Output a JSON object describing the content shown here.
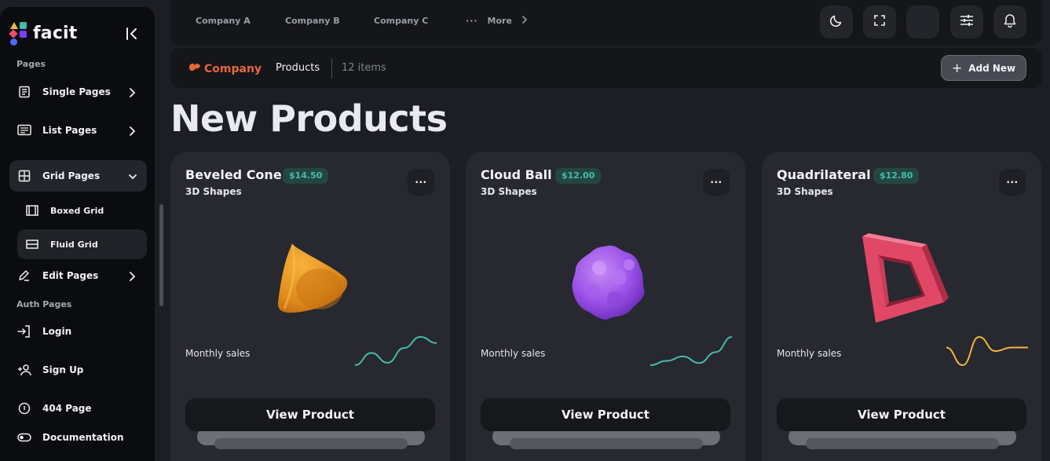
{
  "brand": {
    "name": "facit"
  },
  "sidebar": {
    "sections": [
      {
        "title": "Pages"
      },
      {
        "title": "Auth Pages"
      }
    ],
    "items": [
      {
        "label": "Single Pages",
        "icon": "document-icon"
      },
      {
        "label": "List Pages",
        "icon": "list-icon"
      },
      {
        "label": "Grid Pages",
        "icon": "grid-icon"
      },
      {
        "label": "Boxed Grid",
        "icon": "boxed-grid-icon"
      },
      {
        "label": "Fluid Grid",
        "icon": "fluid-grid-icon"
      },
      {
        "label": "Edit Pages",
        "icon": "edit-icon"
      },
      {
        "label": "Login",
        "icon": "login-icon"
      },
      {
        "label": "Sign Up",
        "icon": "sign-up-icon"
      },
      {
        "label": "404 Page",
        "icon": "info-icon"
      },
      {
        "label": "Documentation",
        "icon": "toggle-icon"
      }
    ]
  },
  "header": {
    "tabs": [
      "Company A",
      "Company B",
      "Company C"
    ],
    "more_label": "More",
    "tools": [
      "dark-mode-icon",
      "fullscreen-icon",
      "language-icon",
      "settings-sliders-icon",
      "notification-bell-icon"
    ]
  },
  "subheader": {
    "brand": "Company",
    "crumb": "Products",
    "count": "12 items",
    "add_label": "Add New"
  },
  "page": {
    "title": "New Products"
  },
  "products": [
    {
      "name": "Beveled Cone",
      "price": "$14.50",
      "category": "3D Shapes",
      "sales_label": "Monthly sales",
      "button": "View Product",
      "trend_color": "#46bcaa",
      "trend": [
        12,
        22,
        14,
        26,
        35,
        30
      ]
    },
    {
      "name": "Cloud Ball",
      "price": "$12.00",
      "category": "3D Shapes",
      "sales_label": "Monthly sales",
      "button": "View Product",
      "trend_color": "#46bcaa",
      "trend": [
        10,
        14,
        18,
        12,
        22,
        36
      ]
    },
    {
      "name": "Quadrilateral",
      "price": "$12.80",
      "category": "3D Shapes",
      "sales_label": "Monthly sales",
      "button": "View Product",
      "trend_color": "#f4b640",
      "trend": [
        20,
        10,
        26,
        18,
        20,
        20
      ]
    }
  ],
  "colors": {
    "accent": "#46bcaa",
    "brand": "#e8663d",
    "warning": "#f4b640"
  }
}
